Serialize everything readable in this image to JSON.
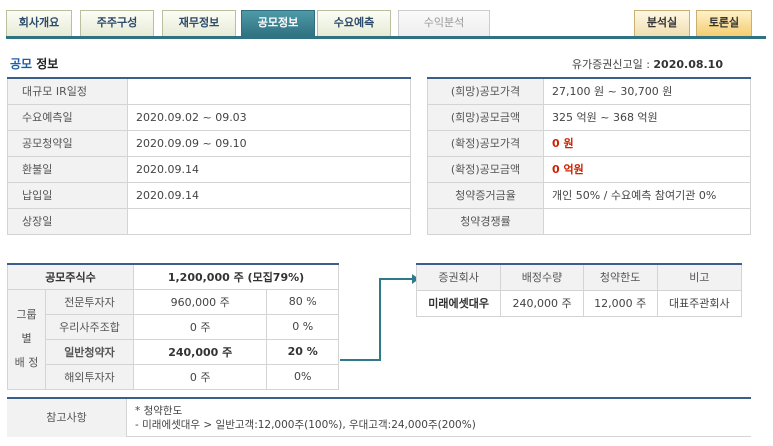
{
  "tabs": [
    {
      "label": "회사개요"
    },
    {
      "label": "주주구성"
    },
    {
      "label": "재무정보"
    },
    {
      "label": "공모정보"
    },
    {
      "label": "수요예측"
    },
    {
      "label": "수익분석"
    },
    {
      "label": "분석실"
    },
    {
      "label": "토론실"
    }
  ],
  "title": {
    "prefix": "공모",
    "suffix": " 정보"
  },
  "reg": {
    "label": "유가증권신고일 : ",
    "date": "2020.08.10"
  },
  "schedule": [
    {
      "label": "대규모 IR일정",
      "value": ""
    },
    {
      "label": "수요예측일",
      "value": "2020.09.02 ~ 09.03"
    },
    {
      "label": "공모청약일",
      "value": "2020.09.09 ~ 09.10"
    },
    {
      "label": "환불일",
      "value": "2020.09.14"
    },
    {
      "label": "납입일",
      "value": "2020.09.14"
    },
    {
      "label": "상장일",
      "value": ""
    }
  ],
  "pricing": [
    {
      "label": "(희망)공모가격",
      "value": "27,100 원 ~ 30,700 원"
    },
    {
      "label": "(희망)공모금액",
      "value": "325 억원  ~ 368 억원"
    },
    {
      "label": "(확정)공모가격",
      "value": "0 원"
    },
    {
      "label": "(확정)공모금액",
      "value": "0 억원"
    },
    {
      "label": "청약증거금율",
      "value": "개인 50% / 수요예측 참여기관 0%"
    },
    {
      "label": "청약경쟁률",
      "value": ""
    }
  ],
  "shares": {
    "total_label": "공모주식수",
    "total_value": "1,200,000 주 (모집79%)",
    "group_label_1": "그룹별",
    "group_label_2": "배 정",
    "rows": [
      {
        "name": "전문투자자",
        "qty": "960,000 주",
        "pct": "80 %"
      },
      {
        "name": "우리사주조합",
        "qty": "0 주",
        "pct": "0 %"
      },
      {
        "name": "일반청약자",
        "qty": "240,000 주",
        "pct": "20 %"
      },
      {
        "name": "해외투자자",
        "qty": "0 주",
        "pct": "0%"
      }
    ]
  },
  "underwriters": {
    "headers": [
      "증권회사",
      "배정수량",
      "청약한도",
      "비고"
    ],
    "rows": [
      {
        "firm": "미래에셋대우",
        "qty": "240,000 주",
        "limit": "12,000 주",
        "note": "대표주관회사"
      }
    ]
  },
  "reference": {
    "label": "참고사항",
    "line1": "* 청약한도",
    "line2": "- 미래에셋대우 > 일반고객:12,000주(100%), 우대고객:24,000주(200%)"
  },
  "colors": {
    "accent": "#2f7282",
    "table_top": "#3b5f8a",
    "connector": "#2f7a8a",
    "highlight_red": "#cc2200"
  }
}
